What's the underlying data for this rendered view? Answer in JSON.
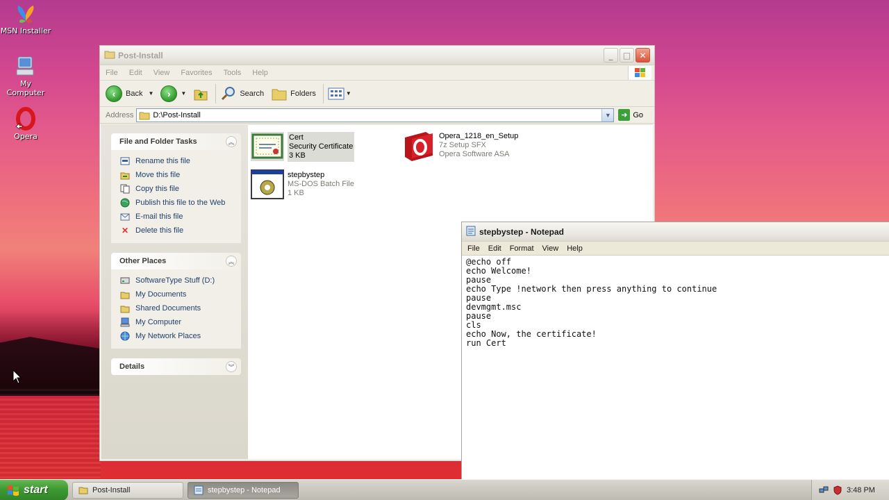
{
  "desktop": {
    "icons": [
      {
        "label": "MSN Installer",
        "icon": "msn-butterfly-icon"
      },
      {
        "label": "My Computer",
        "icon": "computer-icon"
      },
      {
        "label": "Opera",
        "icon": "opera-icon"
      }
    ]
  },
  "explorer": {
    "title": "Post-Install",
    "menu": [
      "File",
      "Edit",
      "View",
      "Favorites",
      "Tools",
      "Help"
    ],
    "toolbar": {
      "back_label": "Back",
      "search_label": "Search",
      "folders_label": "Folders"
    },
    "address": {
      "label": "Address",
      "value": "D:\\Post-Install",
      "go_label": "Go"
    },
    "tasks_panel": {
      "title": "File and Folder Tasks",
      "items": [
        "Rename this file",
        "Move this file",
        "Copy this file",
        "Publish this file to the Web",
        "E-mail this file",
        "Delete this file"
      ]
    },
    "places_panel": {
      "title": "Other Places",
      "items": [
        "SoftwareType Stuff (D:)",
        "My Documents",
        "Shared Documents",
        "My Computer",
        "My Network Places"
      ]
    },
    "details_panel": {
      "title": "Details"
    },
    "files": [
      {
        "name": "Cert",
        "type": "Security Certificate",
        "size": "3 KB"
      },
      {
        "name": "Opera_1218_en_Setup",
        "type": "7z Setup SFX",
        "size": "Opera Software ASA"
      },
      {
        "name": "stepbystep",
        "type": "MS-DOS Batch File",
        "size": "1 KB"
      }
    ]
  },
  "notepad": {
    "title": "stepbystep - Notepad",
    "menu": [
      "File",
      "Edit",
      "Format",
      "View",
      "Help"
    ],
    "content": "@echo off\necho Welcome!\npause\necho Type !network then press anything to continue\npause\ndevmgmt.msc\npause\ncls\necho Now, the certificate!\nrun Cert"
  },
  "taskbar": {
    "start_label": "start",
    "tasks": [
      {
        "label": "Post-Install"
      },
      {
        "label": "stepbystep - Notepad"
      }
    ],
    "clock": "3:48 PM"
  }
}
